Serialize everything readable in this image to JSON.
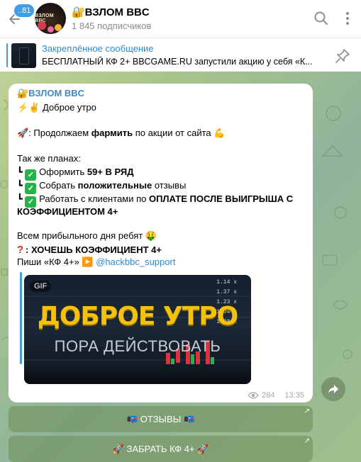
{
  "header": {
    "unread_count": "..81",
    "channel_title": "🔐ВЗЛОМ BBC",
    "subscribers": "1 845 подписчиков",
    "avatar_text": "ВЗЛОМ ВВС"
  },
  "pinned": {
    "title": "Закреплённое сообщение",
    "text": "БЕСПЛАТНЫЙ КФ 2+   BBCGAME.RU запустили акцию у себя «К..."
  },
  "message": {
    "author": "🔐ВЗЛОМ BBC",
    "greeting": "⚡✌ Доброе утро",
    "farm_prefix": "🚀: Продолжаем ",
    "farm_bold": "фармить",
    "farm_suffix": " по акции от сайта 💪",
    "plans_heading": "Так же планах:",
    "plan1_prefix": "Оформить ",
    "plan1_bold": "59+ В РЯД",
    "plan2_prefix": "Собрать ",
    "plan2_bold": "положительные",
    "plan2_suffix": " отзывы",
    "plan3_prefix": "Работать с клиентами по ",
    "plan3_bold": "ОПЛАТЕ ПОСЛЕ ВЫИГРЫША С",
    "plan3_bold_line2": "КОЭФФИЦИЕНТОМ 4+",
    "wish": "Всем прибыльного дня ребят 🤑",
    "question": ": ХОЧЕШЬ КОЭФФИЦИЕНТ 4+",
    "write_prefix": "Пиши «КФ 4+» ▶️ ",
    "write_link": "@hackbbc_support",
    "gif_label": "GIF",
    "gif_title": "ДОБРОЕ УТРО",
    "gif_subtitle": "ПОРА ДЕЙСТВОВАТЬ",
    "gif_odds": [
      "1.14 x",
      "1.37 x",
      "1.23 x",
      "1.54 x",
      "1.38 x"
    ],
    "views": "284",
    "time": "13:35"
  },
  "buttons": [
    {
      "label": "📭 ОТЗЫВЫ 📭"
    },
    {
      "label": "🚀 ЗАБРАТЬ КФ 4+ 🚀"
    }
  ],
  "colors": {
    "accent": "#3e9ee6",
    "link": "#2a8ad6",
    "gif_title": "#f4c20d"
  }
}
